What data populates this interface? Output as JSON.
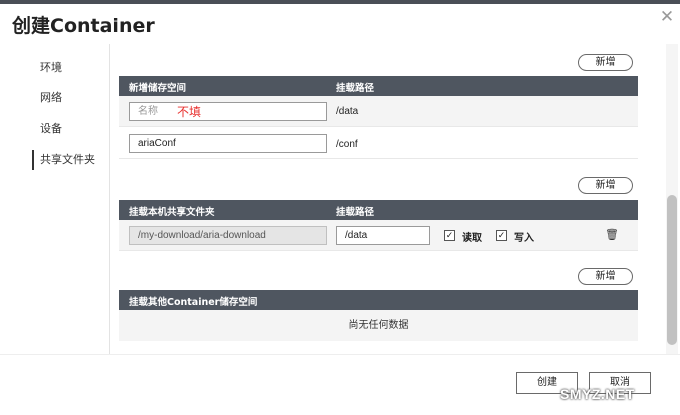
{
  "window": {
    "title": "创建Container"
  },
  "sidebar": {
    "items": [
      {
        "label": "环境"
      },
      {
        "label": "网络"
      },
      {
        "label": "设备"
      },
      {
        "label": "共享文件夹",
        "active": true
      }
    ]
  },
  "buttons": {
    "add": "新增",
    "create": "创建",
    "cancel": "取消"
  },
  "section_new_storage": {
    "col1": "新增储存空间",
    "col2": "挂载路径",
    "rows": [
      {
        "name_placeholder": "名称",
        "annotation": "不填",
        "path": "/data"
      },
      {
        "name_value": "ariaConf",
        "path": "/conf"
      }
    ]
  },
  "section_host_folder": {
    "col1": "挂载本机共享文件夹",
    "col2": "挂载路径",
    "rows": [
      {
        "host_path": "/my-download/aria-download",
        "mount_path": "/data",
        "read_label": "读取",
        "write_label": "写入",
        "read_checked": true,
        "write_checked": true
      }
    ]
  },
  "section_other_container": {
    "col1": "挂载其他Container储存空间",
    "empty_text": "尚无任何数据"
  },
  "watermark": "SMYZ.NET",
  "icons": {
    "close": "close-icon",
    "trash": "trash-icon",
    "check": "checkbox-icon"
  }
}
